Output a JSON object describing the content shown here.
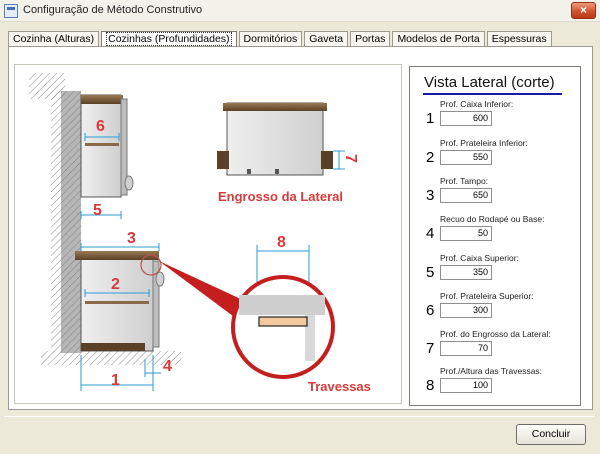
{
  "window": {
    "title": "Configuração de Método Construtivo",
    "close_label": "×"
  },
  "tabs": [
    {
      "label": "Cozinha (Alturas)",
      "active": false
    },
    {
      "label": "Cozinhas (Profundidades)",
      "active": true
    },
    {
      "label": "Dormitórios",
      "active": false
    },
    {
      "label": "Gaveta",
      "active": false
    },
    {
      "label": "Portas",
      "active": false
    },
    {
      "label": "Modelos de Porta",
      "active": false
    },
    {
      "label": "Espessuras",
      "active": false
    }
  ],
  "diagram": {
    "caption_lateral": "Engrosso da Lateral",
    "caption_travessas": "Travessas",
    "markers": [
      "1",
      "2",
      "3",
      "4",
      "5",
      "6",
      "7",
      "8"
    ]
  },
  "side_panel": {
    "title": "Vista Lateral (corte)",
    "fields": [
      {
        "number": "1",
        "label": "Prof. Caixa Inferior:",
        "value": "600"
      },
      {
        "number": "2",
        "label": "Prof. Prateleira Inferior:",
        "value": "550"
      },
      {
        "number": "3",
        "label": "Prof. Tampo:",
        "value": "650"
      },
      {
        "number": "4",
        "label": "Recuo do Rodapé ou Base:",
        "value": "50"
      },
      {
        "number": "5",
        "label": "Prof. Caixa Superior:",
        "value": "350"
      },
      {
        "number": "6",
        "label": "Prof. Prateleira Superior:",
        "value": "300"
      },
      {
        "number": "7",
        "label": "Prof. do Engrosso da Lateral:",
        "value": "70"
      },
      {
        "number": "8",
        "label": "Prof./Altura das Travessas:",
        "value": "100"
      }
    ]
  },
  "footer": {
    "conclude_label": "Concluir"
  },
  "colors": {
    "dimension_red": "#d93a3a",
    "dimension_blue": "#2a9bd6",
    "title_underline": "#1a1aa8"
  }
}
